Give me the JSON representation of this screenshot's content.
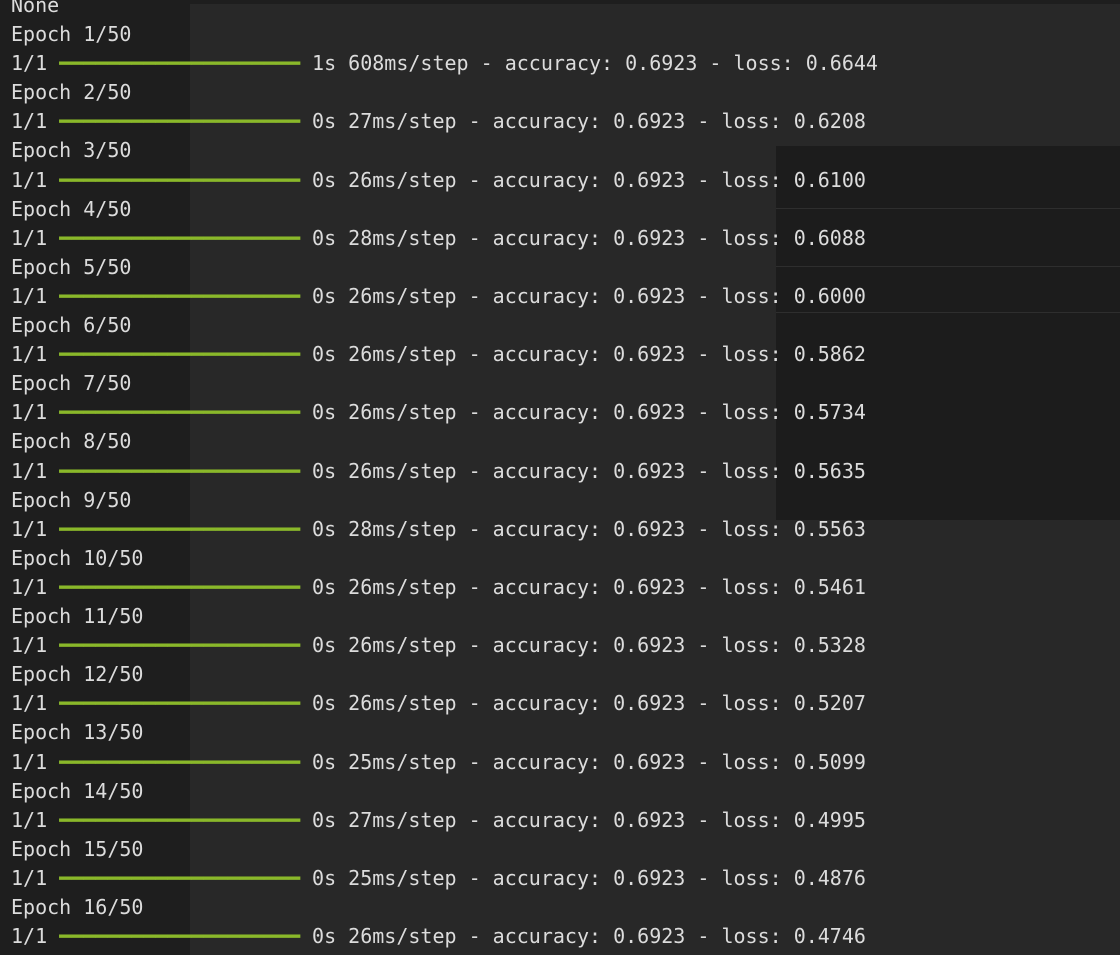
{
  "terminal": {
    "first_line": "None",
    "bar": "━━━━━━━━━━━━━━━━━━━━",
    "epochs": [
      {
        "epoch": "Epoch 1/50",
        "progress": "1/1",
        "stats": "1s 608ms/step - accuracy: 0.6923 - loss: 0.6644"
      },
      {
        "epoch": "Epoch 2/50",
        "progress": "1/1",
        "stats": "0s 27ms/step - accuracy: 0.6923 - loss: 0.6208"
      },
      {
        "epoch": "Epoch 3/50",
        "progress": "1/1",
        "stats": "0s 26ms/step - accuracy: 0.6923 - loss: 0.6100"
      },
      {
        "epoch": "Epoch 4/50",
        "progress": "1/1",
        "stats": "0s 28ms/step - accuracy: 0.6923 - loss: 0.6088"
      },
      {
        "epoch": "Epoch 5/50",
        "progress": "1/1",
        "stats": "0s 26ms/step - accuracy: 0.6923 - loss: 0.6000"
      },
      {
        "epoch": "Epoch 6/50",
        "progress": "1/1",
        "stats": "0s 26ms/step - accuracy: 0.6923 - loss: 0.5862"
      },
      {
        "epoch": "Epoch 7/50",
        "progress": "1/1",
        "stats": "0s 26ms/step - accuracy: 0.6923 - loss: 0.5734"
      },
      {
        "epoch": "Epoch 8/50",
        "progress": "1/1",
        "stats": "0s 26ms/step - accuracy: 0.6923 - loss: 0.5635"
      },
      {
        "epoch": "Epoch 9/50",
        "progress": "1/1",
        "stats": "0s 28ms/step - accuracy: 0.6923 - loss: 0.5563"
      },
      {
        "epoch": "Epoch 10/50",
        "progress": "1/1",
        "stats": "0s 26ms/step - accuracy: 0.6923 - loss: 0.5461"
      },
      {
        "epoch": "Epoch 11/50",
        "progress": "1/1",
        "stats": "0s 26ms/step - accuracy: 0.6923 - loss: 0.5328"
      },
      {
        "epoch": "Epoch 12/50",
        "progress": "1/1",
        "stats": "0s 26ms/step - accuracy: 0.6923 - loss: 0.5207"
      },
      {
        "epoch": "Epoch 13/50",
        "progress": "1/1",
        "stats": "0s 25ms/step - accuracy: 0.6923 - loss: 0.5099"
      },
      {
        "epoch": "Epoch 14/50",
        "progress": "1/1",
        "stats": "0s 27ms/step - accuracy: 0.6923 - loss: 0.4995"
      },
      {
        "epoch": "Epoch 15/50",
        "progress": "1/1",
        "stats": "0s 25ms/step - accuracy: 0.6923 - loss: 0.4876"
      },
      {
        "epoch": "Epoch 16/50",
        "progress": "1/1",
        "stats": "0s 26ms/step - accuracy: 0.6923 - loss: 0.4746"
      }
    ]
  },
  "colors": {
    "background": "#1e1e1e",
    "text": "#dcdcdc",
    "progress_bar": "#8ab82a"
  }
}
